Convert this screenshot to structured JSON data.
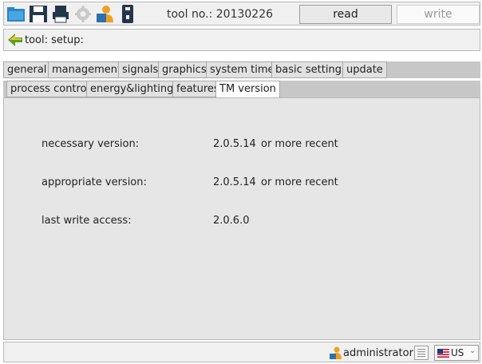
{
  "toolbar": {
    "tool_no": "tool no.: 20130226",
    "read_label": "read",
    "write_label": "write",
    "icons": [
      "open-folder-icon",
      "save-icon",
      "print-icon",
      "settings-gear-icon",
      "user-tools-icon",
      "usb-device-icon"
    ]
  },
  "breadcrumb": {
    "text": "tool: setup:"
  },
  "tabs_row1": [
    {
      "label": "general",
      "active": false
    },
    {
      "label": "management",
      "active": false
    },
    {
      "label": "signals",
      "active": false
    },
    {
      "label": "graphics",
      "active": false
    },
    {
      "label": "system time",
      "active": false
    },
    {
      "label": "basic settings",
      "active": false
    },
    {
      "label": "update",
      "active": false
    }
  ],
  "tabs_row2": [
    {
      "label": "process control",
      "active": false
    },
    {
      "label": "energy&lighting",
      "active": false
    },
    {
      "label": "features",
      "active": false
    },
    {
      "label": "TM version",
      "active": true
    }
  ],
  "content": {
    "necessary_label": "necessary version:",
    "necessary_value": "2.0.5.14",
    "necessary_note": "or more recent",
    "appropriate_label": "appropriate version:",
    "appropriate_value": "2.0.5.14",
    "appropriate_note": "or more recent",
    "last_write_label": "last write access:",
    "last_write_value": "2.0.6.0"
  },
  "status": {
    "user": "administrator",
    "language": "US"
  },
  "colors": {
    "accent_orange": "#f0a020",
    "accent_blue": "#2f6fb0",
    "back_arrow_green": "#5a9e2a"
  }
}
